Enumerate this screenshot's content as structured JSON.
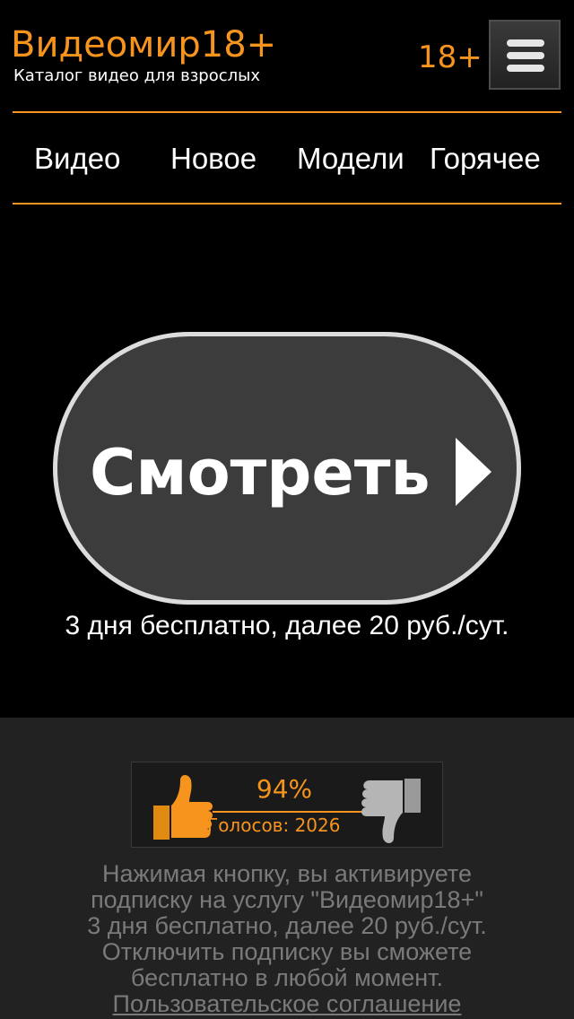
{
  "header": {
    "logo_title": "Видеомир18+",
    "logo_subtitle": "Каталог видео для взрослых",
    "age_badge": "18+",
    "menu_icon": "hamburger-menu-icon"
  },
  "nav": {
    "items": [
      {
        "label": "Видео"
      },
      {
        "label": "Новое"
      },
      {
        "label": "Модели"
      },
      {
        "label": "Горячее"
      }
    ]
  },
  "main": {
    "watch_button_label": "Смотреть",
    "watch_button_icon": "play-arrow-icon",
    "price_note": "3 дня бесплатно, далее 20 руб./сут."
  },
  "rating": {
    "percent": "94%",
    "percent_value": 94,
    "votes": "Голосов: 2026",
    "like_icon": "thumbs-up-icon",
    "dislike_icon": "thumbs-down-icon"
  },
  "disclaimer": {
    "line1": "Нажимая кнопку, вы активируете",
    "line2": "подписку на услугу \"Видеомир18+\"",
    "line3": "3 дня бесплатно, далее 20 руб./сут.",
    "line4": "Отключить подписку вы сможете",
    "line5": "бесплатно в любой момент.",
    "agreement_link": "Пользовательское соглашение"
  },
  "colors": {
    "accent": "#f7941d",
    "background": "#000000",
    "footer_background": "#222222",
    "button_background": "#3c3c3c",
    "muted_text": "#7a7a7a"
  }
}
